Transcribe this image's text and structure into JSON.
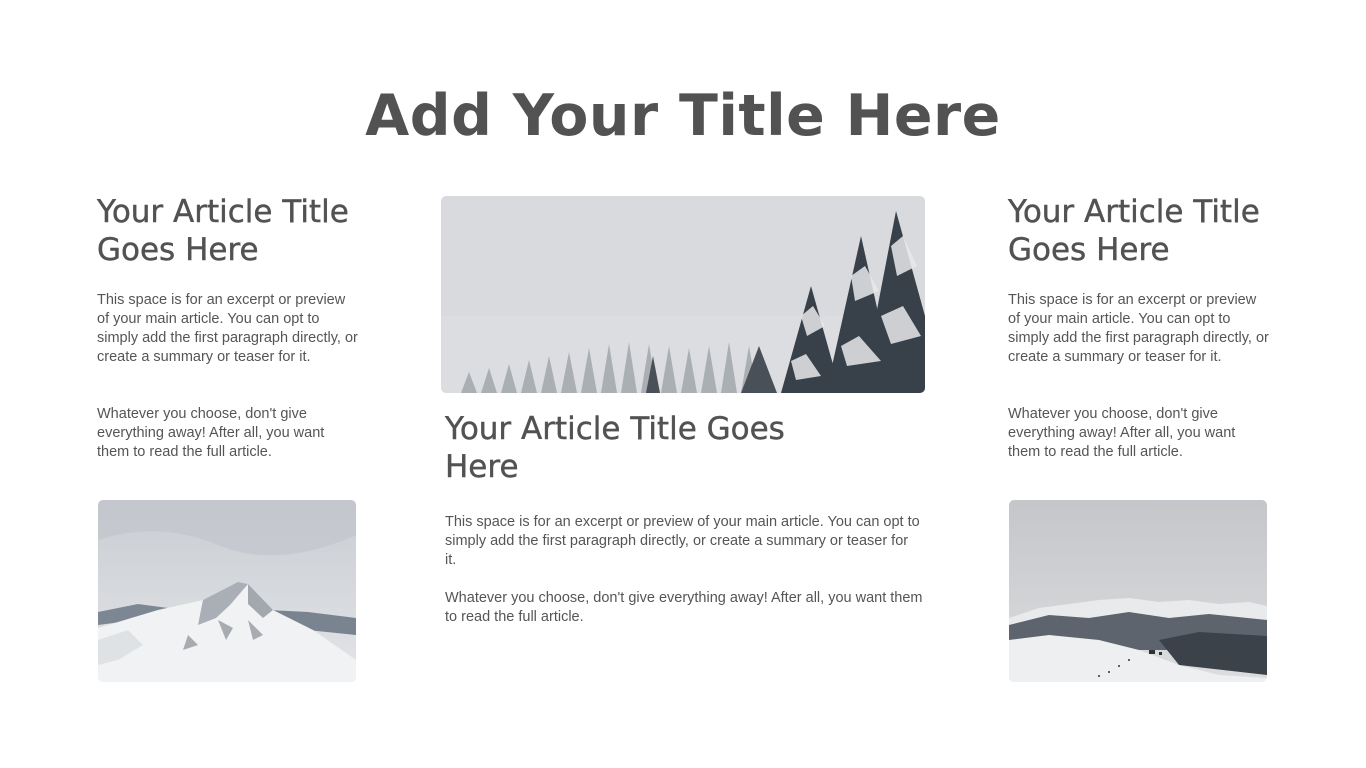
{
  "page": {
    "title": "Add Your Title Here"
  },
  "articles": {
    "left": {
      "title": "Your Article Title Goes Here",
      "paragraph_1": "This space is for an excerpt or preview of your main article. You can opt to simply add the first paragraph directly, or create a summary or teaser for it.",
      "paragraph_2": "Whatever you choose, don't give everything away! After all, you want them to read the full article.",
      "image": "snowy-mountain-peak"
    },
    "center": {
      "title": "Your Article Title Goes Here",
      "paragraph_1": "This space is for an excerpt or preview of your main article. You can opt to simply add the first paragraph directly, or create a summary or teaser for it.",
      "paragraph_2": "Whatever you choose, don't give everything away! After all, you want them to read the full article.",
      "image": "snowy-pine-forest"
    },
    "right": {
      "title": "Your Article Title Goes Here",
      "paragraph_1": "This space is for an excerpt or preview of your main article. You can opt to simply add the first paragraph directly, or create a summary or teaser for it.",
      "paragraph_2": "Whatever you choose, don't give everything away! After all, you want them to read the full article.",
      "image": "snowy-mountain-range-valley"
    }
  },
  "colors": {
    "heading": "#525252",
    "body_text": "#555555",
    "background": "#ffffff"
  }
}
